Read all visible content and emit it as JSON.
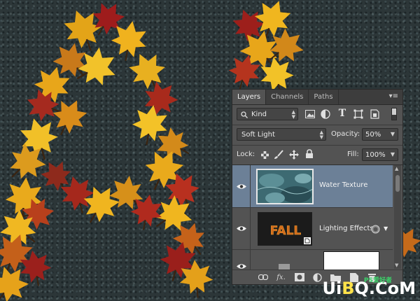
{
  "panel": {
    "tabs": [
      {
        "label": "Layers",
        "active": true
      },
      {
        "label": "Channels",
        "active": false
      },
      {
        "label": "Paths",
        "active": false
      }
    ],
    "filter": {
      "value": "Kind"
    },
    "blend_mode": {
      "value": "Soft Light"
    },
    "opacity": {
      "label": "Opacity:",
      "value": "50%"
    },
    "lock": {
      "label": "Lock:"
    },
    "fill": {
      "label": "Fill:",
      "value": "100%"
    },
    "layers": [
      {
        "name": "Water Texture",
        "selected": true
      },
      {
        "name": "Lighting Effects",
        "selected": false,
        "thumb_text": "FALL"
      },
      {
        "name": "",
        "selected": false
      }
    ]
  },
  "canvas": {
    "letter_shape": "A",
    "words_in_thumb": "FALL"
  },
  "watermark": {
    "text_a": "Ui",
    "text_o": "B",
    "text_b": "Q.",
    "text_c": "CoM",
    "sub": "PS爱好者"
  },
  "colors": {
    "selected_row": "#6c8097",
    "panel_bg": "#535353",
    "accent": "#ffe24a"
  }
}
